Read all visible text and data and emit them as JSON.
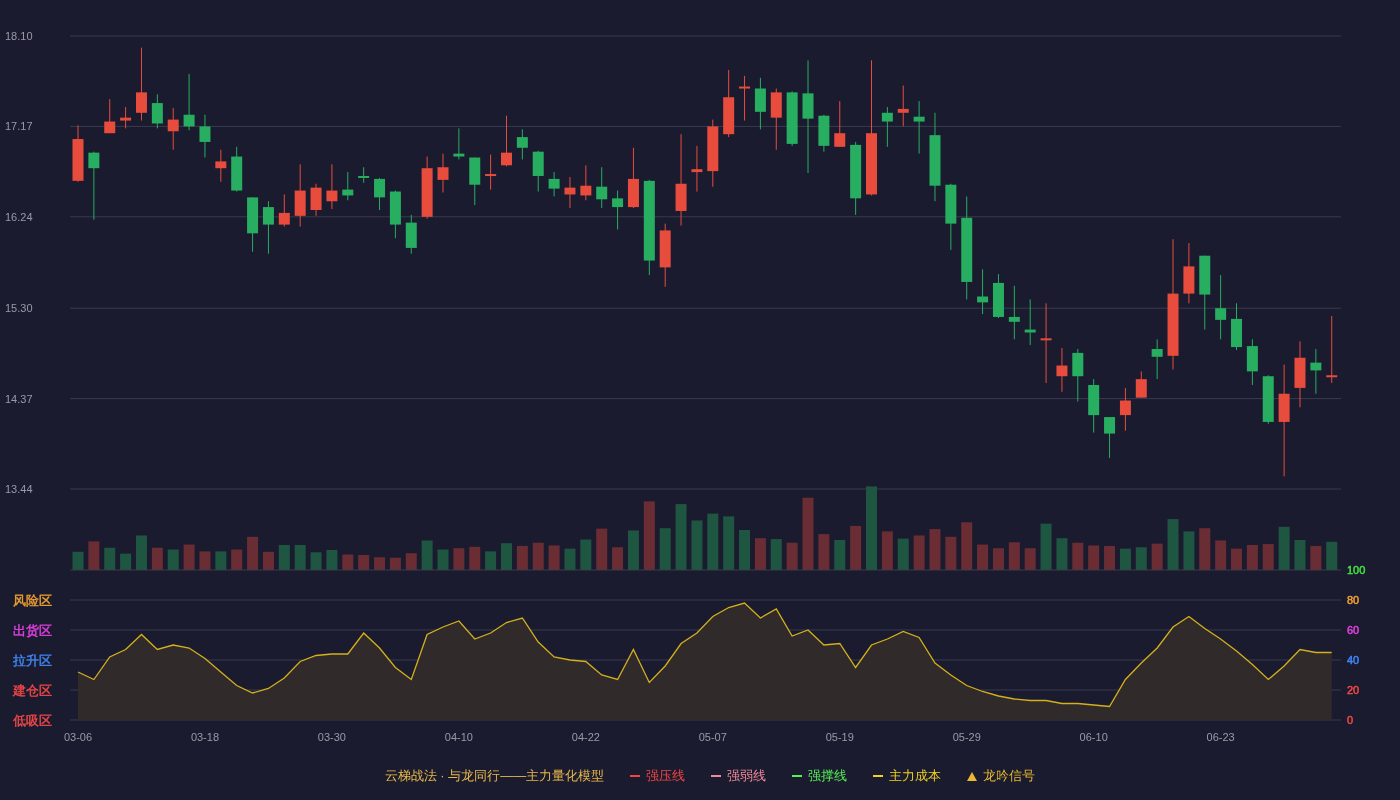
{
  "price_chart": {
    "chart_data": {
      "type": "candlestick",
      "grid": true,
      "ylim": [
        13.44,
        18.1
      ],
      "yticks": [
        {
          "value": 18.1,
          "label": "18.10"
        },
        {
          "value": 17.17,
          "label": "17.17"
        },
        {
          "value": 16.24,
          "label": "16.24"
        },
        {
          "value": 15.3,
          "label": "15.30"
        },
        {
          "value": 14.37,
          "label": "14.37"
        },
        {
          "value": 13.44,
          "label": "13.44"
        }
      ],
      "ohlc": [
        [
          16.61,
          17.18,
          16.6,
          17.04
        ],
        [
          16.9,
          16.91,
          16.21,
          16.74
        ],
        [
          17.1,
          17.45,
          17.1,
          17.22
        ],
        [
          17.23,
          17.37,
          17.15,
          17.26
        ],
        [
          17.31,
          17.98,
          17.23,
          17.52
        ],
        [
          17.41,
          17.5,
          17.15,
          17.2
        ],
        [
          17.12,
          17.36,
          16.93,
          17.24
        ],
        [
          17.29,
          17.71,
          17.13,
          17.17
        ],
        [
          17.17,
          17.29,
          16.85,
          17.01
        ],
        [
          16.74,
          16.93,
          16.6,
          16.81
        ],
        [
          16.86,
          16.96,
          16.5,
          16.51
        ],
        [
          16.44,
          16.44,
          15.88,
          16.07
        ],
        [
          16.34,
          16.4,
          15.86,
          16.16
        ],
        [
          16.16,
          16.47,
          16.14,
          16.28
        ],
        [
          16.25,
          16.78,
          16.14,
          16.51
        ],
        [
          16.31,
          16.58,
          16.25,
          16.54
        ],
        [
          16.4,
          16.78,
          16.32,
          16.51
        ],
        [
          16.52,
          16.7,
          16.41,
          16.46
        ],
        [
          16.66,
          16.75,
          16.59,
          16.64
        ],
        [
          16.63,
          16.64,
          16.31,
          16.44
        ],
        [
          16.5,
          16.51,
          16.02,
          16.16
        ],
        [
          16.18,
          16.26,
          15.86,
          15.92
        ],
        [
          16.24,
          16.86,
          16.22,
          16.74
        ],
        [
          16.62,
          16.89,
          16.49,
          16.75
        ],
        [
          16.89,
          17.15,
          16.83,
          16.86
        ],
        [
          16.85,
          16.85,
          16.36,
          16.57
        ],
        [
          16.66,
          16.88,
          16.52,
          16.68
        ],
        [
          16.77,
          17.28,
          16.76,
          16.9
        ],
        [
          17.06,
          17.14,
          16.83,
          16.95
        ],
        [
          16.91,
          16.92,
          16.5,
          16.66
        ],
        [
          16.63,
          16.7,
          16.45,
          16.53
        ],
        [
          16.47,
          16.65,
          16.33,
          16.54
        ],
        [
          16.46,
          16.77,
          16.41,
          16.56
        ],
        [
          16.55,
          16.75,
          16.33,
          16.42
        ],
        [
          16.43,
          16.51,
          16.11,
          16.34
        ],
        [
          16.34,
          16.95,
          16.33,
          16.63
        ],
        [
          16.61,
          16.62,
          15.64,
          15.79
        ],
        [
          15.72,
          16.17,
          15.52,
          16.1
        ],
        [
          16.3,
          17.09,
          16.15,
          16.58
        ],
        [
          16.7,
          16.97,
          16.5,
          16.73
        ],
        [
          16.71,
          17.24,
          16.55,
          17.17
        ],
        [
          17.09,
          17.75,
          17.06,
          17.47
        ],
        [
          17.56,
          17.69,
          17.23,
          17.58
        ],
        [
          17.56,
          17.67,
          17.14,
          17.32
        ],
        [
          17.26,
          17.56,
          16.93,
          17.52
        ],
        [
          17.52,
          17.53,
          16.97,
          16.99
        ],
        [
          17.51,
          17.85,
          16.69,
          17.25
        ],
        [
          17.28,
          17.29,
          16.91,
          16.97
        ],
        [
          16.96,
          17.43,
          16.96,
          17.1
        ],
        [
          16.98,
          17.01,
          16.26,
          16.43
        ],
        [
          16.47,
          17.85,
          16.46,
          17.1
        ],
        [
          17.31,
          17.37,
          16.96,
          17.22
        ],
        [
          17.31,
          17.59,
          17.17,
          17.35
        ],
        [
          17.27,
          17.43,
          16.89,
          17.22
        ],
        [
          17.08,
          17.31,
          16.4,
          16.56
        ],
        [
          16.57,
          16.58,
          15.9,
          16.17
        ],
        [
          16.23,
          16.45,
          15.39,
          15.57
        ],
        [
          15.42,
          15.7,
          15.24,
          15.36
        ],
        [
          15.56,
          15.65,
          15.2,
          15.21
        ],
        [
          15.21,
          15.53,
          14.98,
          15.16
        ],
        [
          15.08,
          15.39,
          14.92,
          15.05
        ],
        [
          14.97,
          15.35,
          14.53,
          14.99
        ],
        [
          14.6,
          14.89,
          14.44,
          14.71
        ],
        [
          14.84,
          14.88,
          14.34,
          14.6
        ],
        [
          14.51,
          14.57,
          14.02,
          14.2
        ],
        [
          14.18,
          14.18,
          13.76,
          14.01
        ],
        [
          14.2,
          14.48,
          14.04,
          14.35
        ],
        [
          14.38,
          14.65,
          14.38,
          14.57
        ],
        [
          14.88,
          14.98,
          14.57,
          14.8
        ],
        [
          14.81,
          16.01,
          14.67,
          15.45
        ],
        [
          15.45,
          15.97,
          15.35,
          15.73
        ],
        [
          15.84,
          15.84,
          15.08,
          15.44
        ],
        [
          15.3,
          15.64,
          14.98,
          15.18
        ],
        [
          15.19,
          15.35,
          14.87,
          14.9
        ],
        [
          14.91,
          14.98,
          14.51,
          14.65
        ],
        [
          14.6,
          14.61,
          14.11,
          14.13
        ],
        [
          14.13,
          14.72,
          13.57,
          14.42
        ],
        [
          14.48,
          14.96,
          14.28,
          14.79
        ],
        [
          14.74,
          14.88,
          14.42,
          14.66
        ],
        [
          14.59,
          15.22,
          14.53,
          14.61
        ]
      ]
    }
  },
  "volume": {
    "bars": [
      {
        "color": "#1f5641"
      },
      {
        "color": "#6b2d34"
      },
      {
        "color": "#1f5641"
      },
      {
        "color": "#1f5641"
      },
      {
        "color": "#1f5641"
      },
      {
        "color": "#6b2d34"
      },
      {
        "color": "#1f5641"
      },
      {
        "color": "#6b2d34"
      },
      {
        "color": "#6b2d34"
      },
      {
        "color": "#1f5641"
      },
      {
        "color": "#6b2d34"
      },
      {
        "color": "#6b2d34"
      },
      {
        "color": "#6b2d34"
      },
      {
        "color": "#1f5641"
      },
      {
        "color": "#1f5641"
      },
      {
        "color": "#1f5641"
      },
      {
        "color": "#1f5641"
      },
      {
        "color": "#6b2d34"
      },
      {
        "color": "#6b2d34"
      },
      {
        "color": "#6b2d34"
      },
      {
        "color": "#6b2d34"
      },
      {
        "color": "#6b2d34"
      },
      {
        "color": "#1f5641"
      },
      {
        "color": "#1f5641"
      },
      {
        "color": "#6b2d34"
      },
      {
        "color": "#6b2d34"
      },
      {
        "color": "#1f5641"
      },
      {
        "color": "#1f5641"
      },
      {
        "color": "#6b2d34"
      },
      {
        "color": "#6b2d34"
      },
      {
        "color": "#6b2d34"
      },
      {
        "color": "#1f5641"
      },
      {
        "color": "#1f5641"
      },
      {
        "color": "#6b2d34"
      },
      {
        "color": "#6b2d34"
      },
      {
        "color": "#1f5641"
      },
      {
        "color": "#6b2d34"
      },
      {
        "color": "#1f5641"
      },
      {
        "color": "#1f5641"
      },
      {
        "color": "#1f5641"
      },
      {
        "color": "#1f5641"
      },
      {
        "color": "#1f5641"
      },
      {
        "color": "#1f5641"
      },
      {
        "color": "#6b2d34"
      },
      {
        "color": "#1f5641"
      },
      {
        "color": "#6b2d34"
      },
      {
        "color": "#6b2d34"
      },
      {
        "color": "#6b2d34"
      },
      {
        "color": "#1f5641"
      },
      {
        "color": "#6b2d34"
      },
      {
        "color": "#1f5641"
      },
      {
        "color": "#6b2d34"
      },
      {
        "color": "#1f5641"
      },
      {
        "color": "#6b2d34"
      },
      {
        "color": "#6b2d34"
      },
      {
        "color": "#6b2d34"
      },
      {
        "color": "#6b2d34"
      },
      {
        "color": "#6b2d34"
      },
      {
        "color": "#6b2d34"
      },
      {
        "color": "#6b2d34"
      },
      {
        "color": "#6b2d34"
      },
      {
        "color": "#1f5641"
      },
      {
        "color": "#1f5641"
      },
      {
        "color": "#6b2d34"
      },
      {
        "color": "#6b2d34"
      },
      {
        "color": "#6b2d34"
      },
      {
        "color": "#1f5641"
      },
      {
        "color": "#1f5641"
      },
      {
        "color": "#6b2d34"
      },
      {
        "color": "#1f5641"
      },
      {
        "color": "#1f5641"
      },
      {
        "color": "#6b2d34"
      },
      {
        "color": "#6b2d34"
      },
      {
        "color": "#6b2d34"
      },
      {
        "color": "#6b2d34"
      },
      {
        "color": "#6b2d34"
      },
      {
        "color": "#1f5641"
      },
      {
        "color": "#1f5641"
      },
      {
        "color": "#6b2d34"
      },
      {
        "color": "#1f5641"
      }
    ]
  },
  "indicator": {
    "zones": [
      {
        "label": "风险区",
        "color": "#f0a030"
      },
      {
        "label": "出货区",
        "color": "#e040e0"
      },
      {
        "label": "拉升区",
        "color": "#3f86f5"
      },
      {
        "label": "建仓区",
        "color": "#f04848"
      },
      {
        "label": "低吸区",
        "color": "#f04848"
      }
    ],
    "axis_label_colors": [
      {
        "color": "#40e040"
      },
      {
        "color": "#f0a030"
      },
      {
        "color": "#e040e0"
      },
      {
        "color": "#3f86f5"
      },
      {
        "color": "#f04848"
      },
      {
        "color": "#f04848"
      }
    ],
    "chart_data": {
      "type": "area",
      "grid": true,
      "ylim": [
        0,
        100
      ],
      "yticks": [
        {
          "value": 100,
          "label": "100"
        },
        {
          "value": 80,
          "label": "80"
        },
        {
          "value": 60,
          "label": "60"
        },
        {
          "value": 40,
          "label": "40"
        },
        {
          "value": 20,
          "label": "20"
        },
        {
          "value": 0,
          "label": "0"
        }
      ],
      "categories": [
        "03-06",
        null,
        null,
        null,
        null,
        null,
        null,
        null,
        "03-18",
        null,
        null,
        null,
        null,
        null,
        null,
        null,
        "03-30",
        null,
        null,
        null,
        null,
        null,
        null,
        null,
        "04-10",
        null,
        null,
        null,
        null,
        null,
        null,
        null,
        "04-22",
        null,
        null,
        null,
        null,
        null,
        null,
        null,
        "05-07",
        null,
        null,
        null,
        null,
        null,
        null,
        null,
        "05-19",
        null,
        null,
        null,
        null,
        null,
        null,
        null,
        "05-29",
        null,
        null,
        null,
        null,
        null,
        null,
        null,
        "06-10",
        null,
        null,
        null,
        null,
        null,
        null,
        null,
        "06-23",
        null,
        null,
        null,
        null,
        null,
        null,
        null
      ],
      "series": [
        {
          "color": "#d4b01c",
          "values": [
            32,
            27,
            42,
            47,
            57,
            47,
            50,
            48,
            41,
            32,
            23,
            18,
            21,
            28,
            39,
            43,
            44,
            44,
            58,
            48,
            35,
            27,
            57,
            62,
            66,
            54,
            58,
            65,
            68,
            52,
            42,
            40,
            39,
            30,
            27,
            47,
            25,
            36,
            51,
            58,
            69,
            75,
            78,
            68,
            74,
            56,
            60,
            50,
            51,
            35,
            50,
            54,
            59,
            55,
            38,
            30,
            23,
            19,
            16,
            14,
            13,
            13,
            11,
            11,
            10,
            9,
            27,
            38,
            48,
            62,
            69,
            61,
            54,
            46,
            37,
            27,
            36,
            47,
            45,
            45
          ]
        }
      ]
    }
  },
  "legend": {
    "title": "云梯战法 · 与龙同行——主力量化模型",
    "items": [
      {
        "label": "强压线",
        "kind": "solid",
        "color": "#f04444"
      },
      {
        "label": "强弱线",
        "kind": "dashed",
        "color": "#f08a9a"
      },
      {
        "label": "强撑线",
        "kind": "solid",
        "color": "#55f055"
      },
      {
        "label": "主力成本",
        "kind": "dashed",
        "color": "#f0d020"
      },
      {
        "label": "龙吟信号",
        "kind": "triangle",
        "color": "#e8b830"
      }
    ]
  }
}
